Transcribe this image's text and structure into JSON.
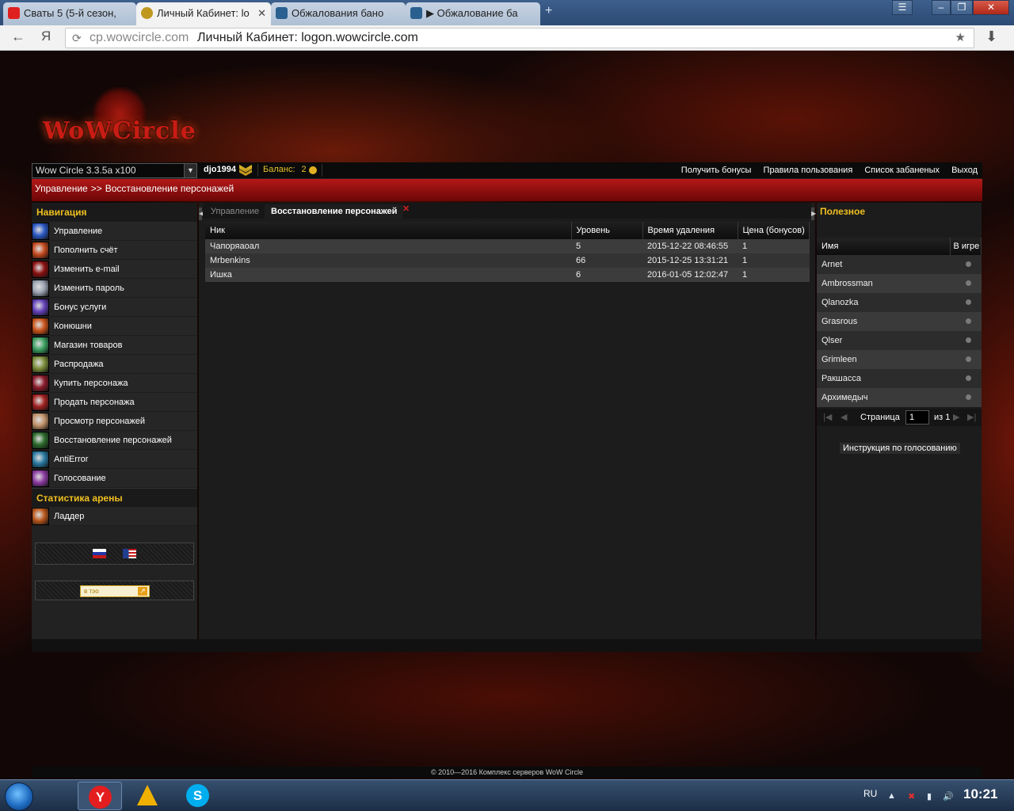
{
  "browser": {
    "tabs": [
      {
        "label": "Сваты 5 (5-й сезон,",
        "active": false
      },
      {
        "label": "Личный Кабинет: lo",
        "active": true
      },
      {
        "label": "Обжалования бано",
        "active": false
      },
      {
        "label": "▶ Обжалование ба",
        "active": false
      }
    ],
    "new_tab": "+",
    "window_buttons": {
      "menu": "☰",
      "minimize": "–",
      "maximize": "❐",
      "close": "✕"
    },
    "back": "←",
    "yandex_button": "Я",
    "refresh": "⟳",
    "url_host": "cp.wowcircle.com",
    "url_title": "Личный Кабинет: logon.wowcircle.com",
    "bookmark": "★",
    "download": "⬇"
  },
  "logo": {
    "text": "WoWCircle"
  },
  "topbar": {
    "realm": "Wow Circle 3.3.5a x100",
    "realm_arrow": "▼",
    "user": "djo1994",
    "balance_label": "Баланс:",
    "balance_value": "2",
    "links": [
      "Получить бонусы",
      "Правила пользования",
      "Список забаненых",
      "Выход"
    ]
  },
  "breadcrumb": {
    "parts": [
      "Управление",
      ">>",
      "Восстановление персонажей"
    ]
  },
  "navigation": {
    "title": "Навигация",
    "items": [
      {
        "label": "Управление",
        "color": "#2a58c4"
      },
      {
        "label": "Пополнить счёт",
        "color": "#c4491c"
      },
      {
        "label": "Изменить e-mail",
        "color": "#8a1010"
      },
      {
        "label": "Изменить пароль",
        "color": "#9aa2b0"
      },
      {
        "label": "Бонус услуги",
        "color": "#6240b8"
      },
      {
        "label": "Конюшни",
        "color": "#c85218"
      },
      {
        "label": "Магазин товаров",
        "color": "#3aa060"
      },
      {
        "label": "Распродажа",
        "color": "#7a8c38"
      },
      {
        "label": "Купить персонажа",
        "color": "#8a1a2a"
      },
      {
        "label": "Продать персонажа",
        "color": "#a02020"
      },
      {
        "label": "Просмотр персонажей",
        "color": "#c09068"
      },
      {
        "label": "Восстановление персонажей",
        "color": "#2c6a2c"
      },
      {
        "label": "AntiError",
        "color": "#2878a0"
      },
      {
        "label": "Голосование",
        "color": "#8a3aa0"
      }
    ]
  },
  "arena": {
    "title": "Статистика арены",
    "items": [
      {
        "label": "Ладдер",
        "color": "#b8561c"
      }
    ]
  },
  "widgets": {
    "badge_text": "в тэо",
    "badge_arrow": "↗"
  },
  "center": {
    "tabs": [
      "Управление",
      "Восстановление персонажей"
    ],
    "tab_close": "✕",
    "collapse_left": "◀",
    "collapse_right": "▶",
    "columns": [
      "Ник",
      "Уровень",
      "Время удаления",
      "Цена (бонусов)"
    ],
    "rows": [
      [
        "Чапоряаоал",
        "5",
        "2015-12-22 08:46:55",
        "1"
      ],
      [
        "Mrbenkins",
        "66",
        "2015-12-25 13:31:21",
        "1"
      ],
      [
        "Ишка",
        "6",
        "2016-01-05 12:02:47",
        "1"
      ]
    ]
  },
  "useful": {
    "title": "Полезное",
    "columns": [
      "Имя",
      "В игре"
    ],
    "rows": [
      "Arnet",
      "Ambrossman",
      "Qlanozka",
      "Grasrous",
      "Qlser",
      "Grimleen",
      "Ракшасса",
      "Архимедыч"
    ],
    "pager": {
      "first": "|◀",
      "prev": "◀",
      "label": "Страница",
      "page": "1",
      "of": "из 1",
      "next": "▶",
      "last": "▶|"
    },
    "instruction": "Инструкция по голосованию"
  },
  "footer": {
    "copyright": "© 2010—2016 Комплекс серверов WoW Circle"
  },
  "taskbar": {
    "yandex": "Y",
    "skype": "S",
    "lang": "RU",
    "tray_icons": [
      "▲",
      "✖",
      "▮",
      "🔊"
    ],
    "time": "10:21"
  }
}
